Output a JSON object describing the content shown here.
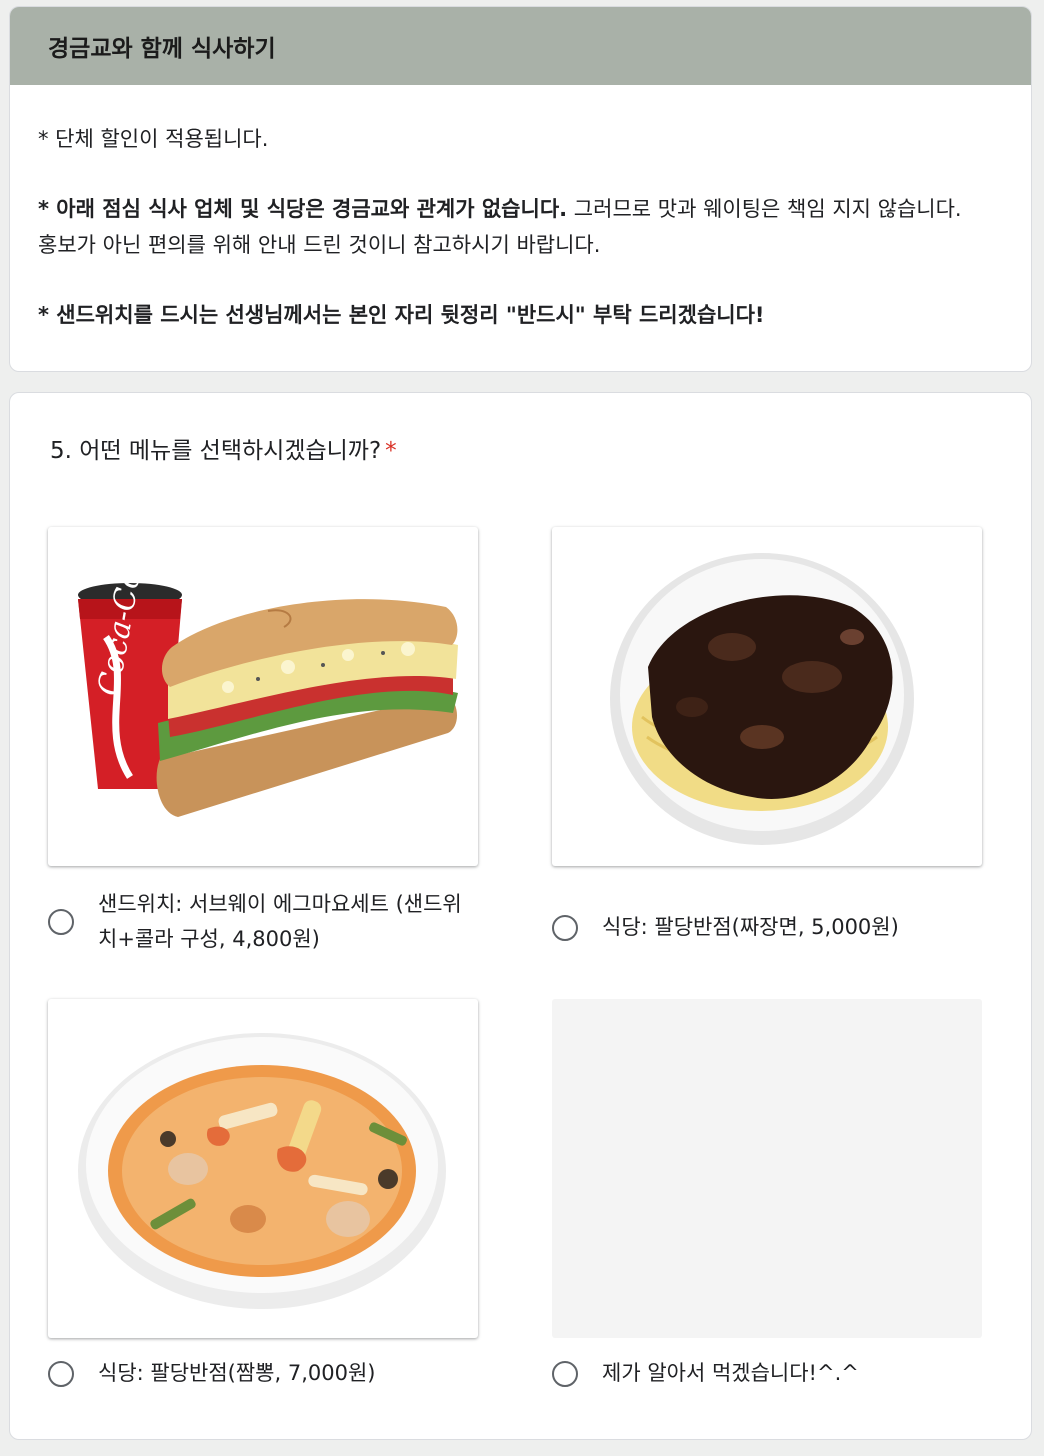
{
  "section": {
    "title": "경금교와 함께 식사하기",
    "line1": "* 단체 할인이 적용됩니다.",
    "line2_bold": "* 아래 점심 식사 업체 및 식당은 경금교와 관계가 없습니다.",
    "line2_rest": " 그러므로 맛과 웨이팅은 책임 지지 않습니다.",
    "line3": "홍보가 아닌 편의를 위해 안내 드린 것이니 참고하시기 바랍니다.",
    "line4_bold": "* 샌드위치를 드시는 선생님께서는 본인 자리 뒷정리 \"반드시\" 부탁 드리겠습니다!"
  },
  "question": {
    "title": "5. 어떤 메뉴를 선택하시겠습니까?",
    "required_mark": "*",
    "options": [
      {
        "label": "샌드위치: 서브웨이 에그마요세트 (샌드위치+콜라 구성, 4,800원)",
        "image": "sandwich-cola"
      },
      {
        "label": "식당: 팔당반점(짜장면, 5,000원)",
        "image": "jajangmyeon"
      },
      {
        "label": "식당: 팔당반점(짬뽕, 7,000원)",
        "image": "jjamppong"
      },
      {
        "label": "제가 알아서 먹겠습니다!^.^",
        "image": "none"
      }
    ]
  },
  "colors": {
    "header_bg": "#a9b1a8",
    "required": "#d93025",
    "cola_red": "#d41f26"
  }
}
